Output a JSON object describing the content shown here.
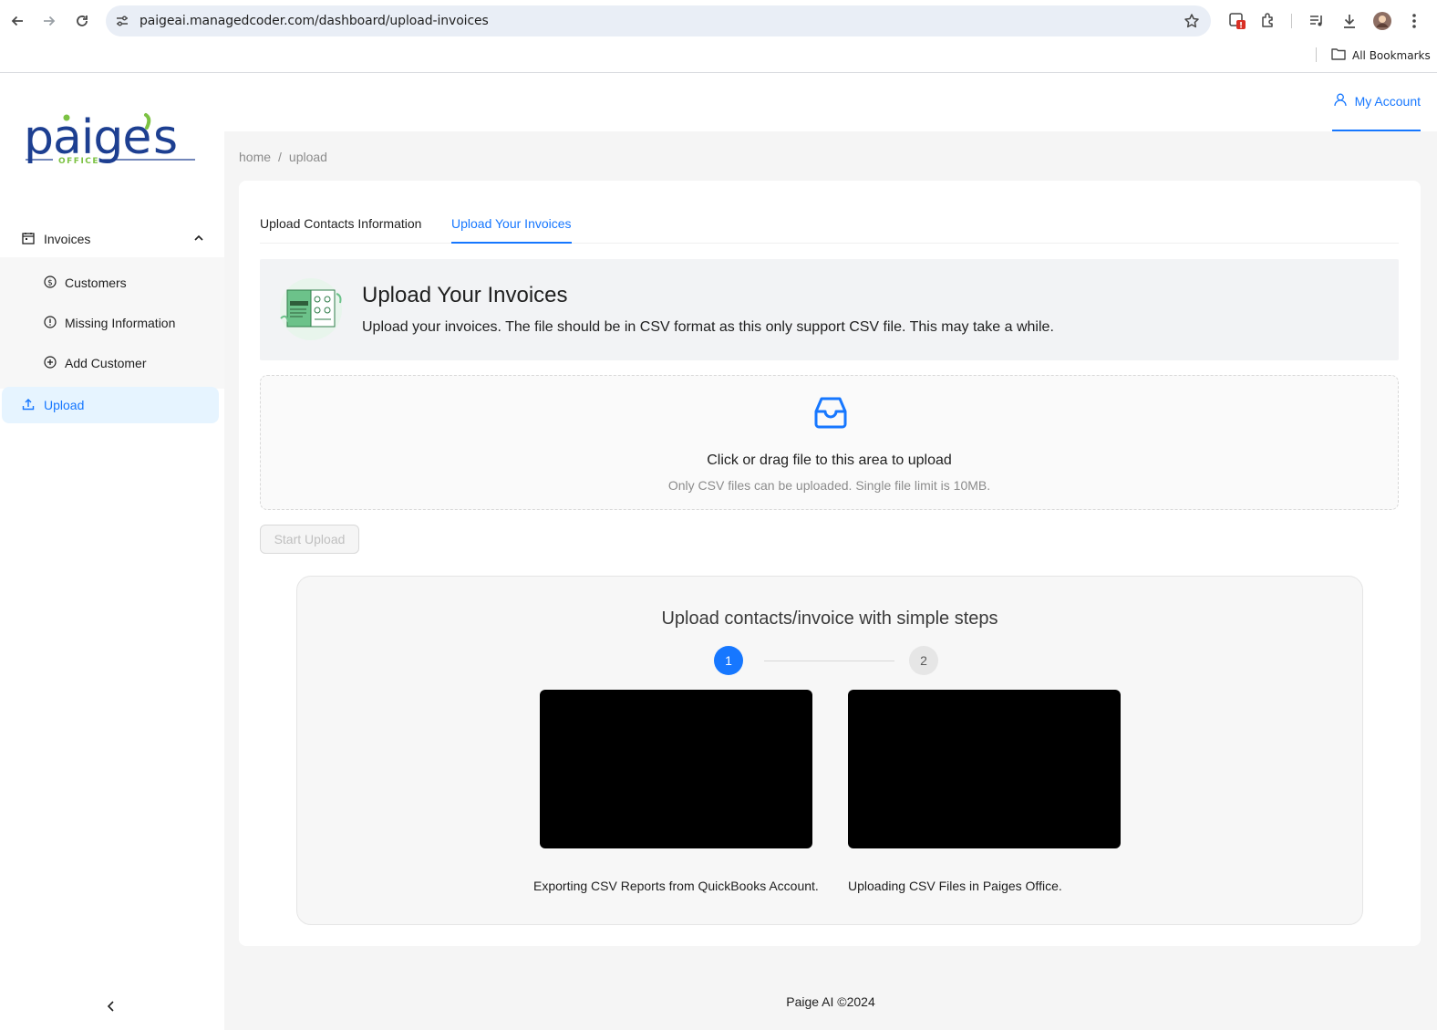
{
  "browser": {
    "url": "paigeai.managedcoder.com/dashboard/upload-invoices",
    "all_bookmarks": "All Bookmarks"
  },
  "header": {
    "account_label": "My Account"
  },
  "sidebar": {
    "logo_text": "paige's",
    "logo_subtext": "OFFICE",
    "group_label": "Invoices",
    "items": [
      {
        "label": "Customers",
        "icon": "dollar-circle-icon"
      },
      {
        "label": "Missing Information",
        "icon": "exclamation-circle-icon"
      },
      {
        "label": "Add Customer",
        "icon": "plus-circle-icon"
      }
    ],
    "active_item": {
      "label": "Upload",
      "icon": "upload-icon"
    }
  },
  "breadcrumb": {
    "home": "home",
    "separator": "/",
    "current": "upload"
  },
  "tabs": [
    {
      "label": "Upload Contacts Information",
      "active": false
    },
    {
      "label": "Upload Your Invoices",
      "active": true
    }
  ],
  "info": {
    "title": "Upload Your Invoices",
    "description": "Upload your invoices. The file should be in CSV format as this only support CSV file. This may take a while."
  },
  "dropzone": {
    "main_text": "Click or drag file to this area to upload",
    "hint": "Only CSV files can be uploaded. Single file limit is 10MB."
  },
  "start_upload_label": "Start Upload",
  "steps": {
    "title": "Upload contacts/invoice with simple steps",
    "items": [
      {
        "number": "1",
        "caption": "Exporting CSV Reports from QuickBooks Account."
      },
      {
        "number": "2",
        "caption": "Uploading CSV Files in Paiges Office."
      }
    ]
  },
  "footer": "Paige AI ©2024",
  "colors": {
    "accent": "#1677ff",
    "logo_blue": "#1d3f91",
    "logo_green": "#7cc243"
  }
}
